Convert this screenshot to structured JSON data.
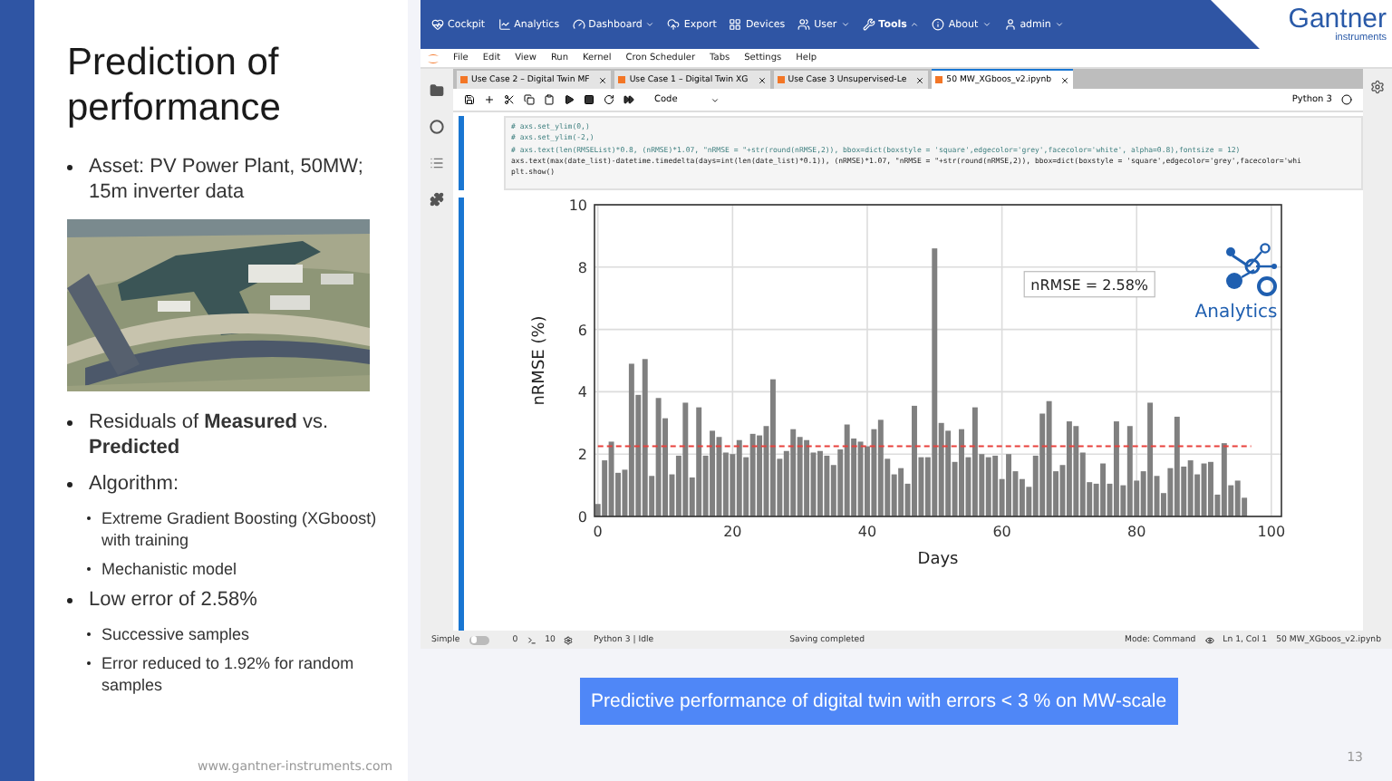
{
  "slide": {
    "title": "Prediction of performance",
    "intro_bullet": {
      "text": "Asset: PV Power Plant, 50MW; 15m inverter data"
    },
    "bullets": [
      {
        "text": "Residuals of **Measured** vs. **Predicted**"
      },
      {
        "text": "Algorithm:",
        "children": [
          {
            "text": "Extreme Gradient Boosting (XGboost) with training"
          },
          {
            "text": "Mechanistic model"
          }
        ]
      },
      {
        "text": "Low error of 2.58%",
        "children": [
          {
            "text": "Successive samples"
          },
          {
            "text": "Error reduced to 1.92% for random samples"
          }
        ]
      }
    ],
    "footer_url": "www.gantner-instruments.com",
    "caption": "Predictive performance of digital twin with errors < 3 % on MW-scale",
    "page_number": "13"
  },
  "app": {
    "logo": {
      "name": "Gantner",
      "subtitle": "instruments"
    },
    "nav": [
      {
        "label": "Cockpit",
        "menu": false,
        "expanded": false
      },
      {
        "label": "Analytics",
        "menu": false,
        "expanded": false
      },
      {
        "label": "Dashboard",
        "menu": true,
        "expanded": false
      },
      {
        "label": "Export",
        "menu": false,
        "expanded": false
      },
      {
        "label": "Devices",
        "menu": false,
        "expanded": false
      },
      {
        "label": "User",
        "menu": true,
        "expanded": false
      },
      {
        "label": "Tools",
        "menu": true,
        "expanded": true
      },
      {
        "label": "About",
        "menu": true,
        "expanded": false
      },
      {
        "label": "admin",
        "menu": true,
        "expanded": false
      }
    ],
    "menu": [
      "File",
      "Edit",
      "View",
      "Run",
      "Kernel",
      "Cron Scheduler",
      "Tabs",
      "Settings",
      "Help"
    ],
    "tabs": [
      {
        "label": "Use Case 2 – Digital Twin MF",
        "selected": false
      },
      {
        "label": "Use Case 1 – Digital Twin XG",
        "selected": false
      },
      {
        "label": "Use Case 3 Unsupervised-Le",
        "selected": false
      },
      {
        "label": "50 MW_XGboos_v2.ipynb",
        "selected": true
      }
    ],
    "toolbar": {
      "cell_type": "Code",
      "kernel": "Python 3"
    },
    "code_lines": [
      "# axs.set_ylim(0,)",
      "# axs.set_ylim(-2,)",
      "# axs.text(len(RMSEList)*0.8, (nRMSE)*1.07, \"nRMSE = \"+str(round(nRMSE,2)), bbox=dict(boxstyle = 'square',edgecolor='grey',facecolor='white', alpha=0.8),fontsize = 12)",
      "axs.text(max(date_list)-datetime.timedelta(days=int(len(date_list)*0.1)), (nRMSE)*1.07, \"nRMSE = \"+str(round(nRMSE,2)), bbox=dict(boxstyle = 'square',edgecolor='grey',facecolor='whi",
      "plt.show()"
    ],
    "output": {
      "logo_text": "Analytics",
      "chart_data": {
        "type": "bar",
        "xlabel": "Days",
        "ylabel": "nRMSE (%)",
        "xlim": [
          -0.5,
          101.5
        ],
        "ylim": [
          0,
          10
        ],
        "xticks": [
          0,
          20,
          40,
          60,
          80,
          100
        ],
        "yticks": [
          0,
          2,
          4,
          6,
          8,
          10
        ],
        "x": [
          0,
          1,
          2,
          3,
          4,
          5,
          6,
          7,
          8,
          9,
          10,
          11,
          12,
          13,
          14,
          15,
          16,
          17,
          18,
          19,
          20,
          21,
          22,
          23,
          24,
          25,
          26,
          27,
          28,
          29,
          30,
          31,
          32,
          33,
          34,
          35,
          36,
          37,
          38,
          39,
          40,
          41,
          42,
          43,
          44,
          45,
          46,
          47,
          48,
          49,
          50,
          51,
          52,
          53,
          54,
          55,
          56,
          57,
          58,
          59,
          60,
          61,
          62,
          63,
          64,
          65,
          66,
          67,
          68,
          69,
          70,
          71,
          72,
          73,
          74,
          75,
          76,
          77,
          78,
          79,
          80,
          81,
          82,
          83,
          84,
          85,
          86,
          87,
          88,
          89,
          90,
          91,
          92,
          93,
          94,
          95,
          96
        ],
        "grid": true,
        "series": [
          {
            "color": "#808080",
            "values": [
              0.4,
              1.8,
              2.4,
              1.4,
              1.5,
              4.9,
              3.9,
              5.05,
              1.3,
              3.8,
              3.15,
              1.35,
              1.95,
              3.65,
              1.25,
              3.5,
              1.95,
              2.75,
              2.55,
              2.05,
              2.0,
              2.45,
              1.9,
              2.65,
              2.6,
              2.9,
              4.4,
              1.85,
              2.1,
              2.8,
              2.55,
              2.45,
              2.05,
              2.1,
              1.95,
              1.65,
              2.15,
              2.95,
              2.5,
              2.4,
              2.25,
              2.8,
              3.1,
              1.85,
              1.35,
              1.55,
              1.05,
              3.55,
              1.9,
              1.9,
              8.6,
              3.0,
              2.75,
              1.75,
              2.8,
              1.9,
              3.5,
              2.0,
              1.9,
              1.95,
              1.2,
              2.0,
              1.45,
              1.2,
              0.95,
              1.95,
              3.3,
              3.7,
              1.45,
              1.65,
              3.05,
              2.9,
              2.05,
              1.1,
              1.05,
              1.7,
              1.05,
              3.05,
              1.0,
              2.9,
              1.15,
              1.45,
              3.65,
              1.3,
              0.75,
              1.55,
              3.2,
              1.6,
              1.8,
              1.35,
              1.7,
              1.75,
              0.7,
              2.35,
              1.0,
              1.15,
              0.6
            ]
          }
        ],
        "ref_lines": [
          {
            "axis": "y",
            "value": 2.25,
            "color": "#e8413c"
          }
        ],
        "annotations": [
          "nRMSE = 2.58%"
        ]
      }
    },
    "status": {
      "mode_label": "Simple",
      "simple_on": false,
      "terminals": "0",
      "kernels": "10",
      "kernel_status": "Python 3 | Idle",
      "message": "Saving completed",
      "mode": "Mode: Command",
      "cursor": "Ln 1, Col 1",
      "file": "50 MW_XGboos_v2.ipynb"
    }
  }
}
